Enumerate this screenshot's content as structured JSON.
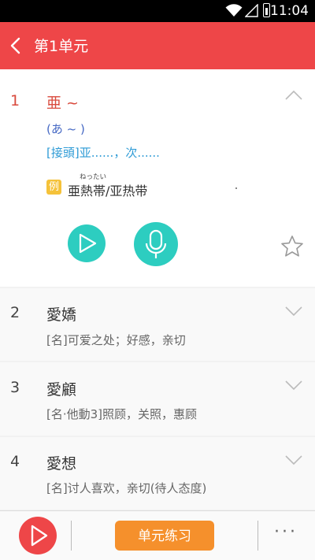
{
  "status": {
    "time": "11:04"
  },
  "header": {
    "title": "第1单元"
  },
  "words": [
    {
      "num": "1",
      "word": "亜 ~",
      "kana": "(あ ~ )",
      "definition": "[接頭]亚......，次......",
      "example_label": "例",
      "example_ruby": "ねったい",
      "example": "亜熱帯/亚热带"
    },
    {
      "num": "2",
      "word": "愛嬌",
      "meaning": "[名]可爱之处；好感，亲切"
    },
    {
      "num": "3",
      "word": "愛顧",
      "meaning": "[名·他動3]照顾，关照，惠顾"
    },
    {
      "num": "4",
      "word": "愛想",
      "meaning": "[名]讨人喜欢，亲切(待人态度)"
    }
  ],
  "bottom": {
    "practice_label": "单元练习",
    "more_label": "···"
  },
  "colors": {
    "primary": "#ee4648",
    "accent": "#2dcdc0",
    "button": "#f5902c",
    "badge": "#f5c23a"
  },
  "icons": [
    "wifi-icon",
    "signal-icon",
    "battery-icon",
    "back-arrow-icon",
    "chevron-up-icon",
    "chevron-down-icon",
    "play-icon",
    "microphone-icon",
    "star-icon",
    "more-icon"
  ]
}
